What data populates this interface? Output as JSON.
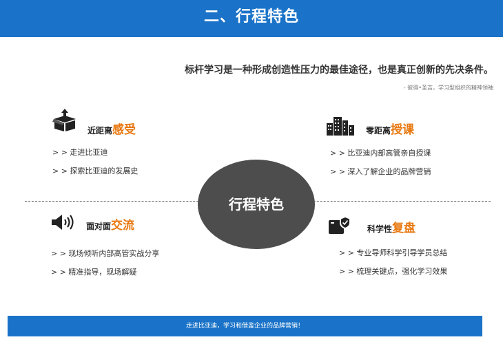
{
  "header": {
    "title": "二、行程特色"
  },
  "quote": {
    "text": "标杆学习是一种形成创造性压力的最佳途径，也是真正创新的先决条件。",
    "source": "- 彼得•圣吉，学习型组织的精神领袖"
  },
  "center": {
    "label": "行程特色"
  },
  "quadrants": {
    "top_left": {
      "icon": "box-upload-icon",
      "title_prefix": "近距离",
      "title_emphasis": "感受",
      "items": [
        "> > 走进比亚迪",
        "> > 探索比亚迪的发展史"
      ]
    },
    "top_right": {
      "icon": "buildings-icon",
      "title_prefix": "零距离",
      "title_emphasis": "授课",
      "items": [
        "> > 比亚迪内部高管亲自授课",
        "> > 深入了解企业的品牌营销"
      ]
    },
    "bottom_left": {
      "icon": "speaker-icon",
      "title_prefix": "面对面",
      "title_emphasis": "交流",
      "items": [
        "> > 现场倾听内部高管实战分享",
        "> > 精准指导，现场解疑"
      ]
    },
    "bottom_right": {
      "icon": "shield-box-icon",
      "title_prefix": "科学性",
      "title_emphasis": "复盘",
      "items": [
        "> > 专业导师科学引导学员总结",
        "> > 梳理关键点，强化学习效果"
      ]
    }
  },
  "footer": {
    "text": "走进比亚迪，学习和借鉴企业的品牌营销！"
  },
  "colors": {
    "accent_blue": "#1a73c8",
    "emphasis_orange": "#e8770e",
    "center_gray": "#4d4d4d"
  }
}
